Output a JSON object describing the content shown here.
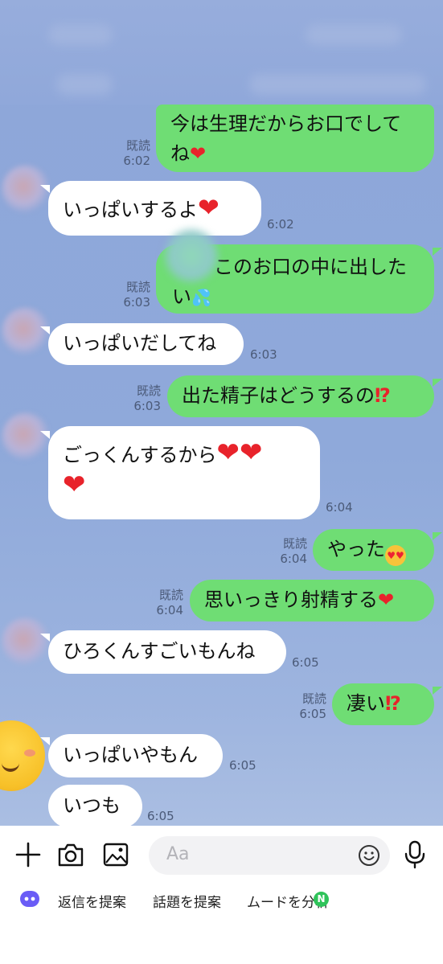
{
  "input": {
    "placeholder": "Aa"
  },
  "messages": [
    {
      "side": "out",
      "lines": [
        "今は生理だからお口でして",
        "ね"
      ],
      "suffix_icon": "heart",
      "read": "既読",
      "time": "6:02"
    },
    {
      "side": "in",
      "text": "いっぱいするよ",
      "suffix_icon": "heart",
      "time": "6:02"
    },
    {
      "side": "out",
      "lines": [
        "このお口の中に出した",
        "い"
      ],
      "suffix_icon": "sweat-droplets",
      "read": "既読",
      "time": "6:03"
    },
    {
      "side": "in",
      "text": "いっぱいだしてね",
      "time": "6:03"
    },
    {
      "side": "out",
      "text": "出た精子はどうするの",
      "suffix_icon": "exclamation-question",
      "read": "既読",
      "time": "6:03"
    },
    {
      "side": "in",
      "lines": [
        "ごっくんするから",
        ""
      ],
      "suffix_icon": "hearts",
      "time": "6:04"
    },
    {
      "side": "out",
      "text": "やった",
      "suffix_icon": "heart-eyes-face",
      "read": "既読",
      "time": "6:04"
    },
    {
      "side": "out",
      "text": "思いっきり射精する",
      "suffix_icon": "heart",
      "read": "既読",
      "time": "6:04"
    },
    {
      "side": "in",
      "text": "ひろくんすごいもんね",
      "time": "6:05"
    },
    {
      "side": "out",
      "text": "凄い",
      "suffix_icon": "exclamation-question",
      "read": "既読",
      "time": "6:05"
    },
    {
      "side": "in",
      "text": "いっぱいやもん",
      "time": "6:05"
    },
    {
      "side": "in",
      "text": "いつも",
      "time": "6:05"
    }
  ],
  "toolbar": {
    "icons": [
      "plus-icon",
      "camera-icon",
      "image-icon",
      "emoji-icon",
      "mic-icon"
    ]
  },
  "suggestions": [
    {
      "label": "返信を提案"
    },
    {
      "label": "話題を提案"
    },
    {
      "label": "ムードを分析",
      "badge": "N"
    }
  ]
}
